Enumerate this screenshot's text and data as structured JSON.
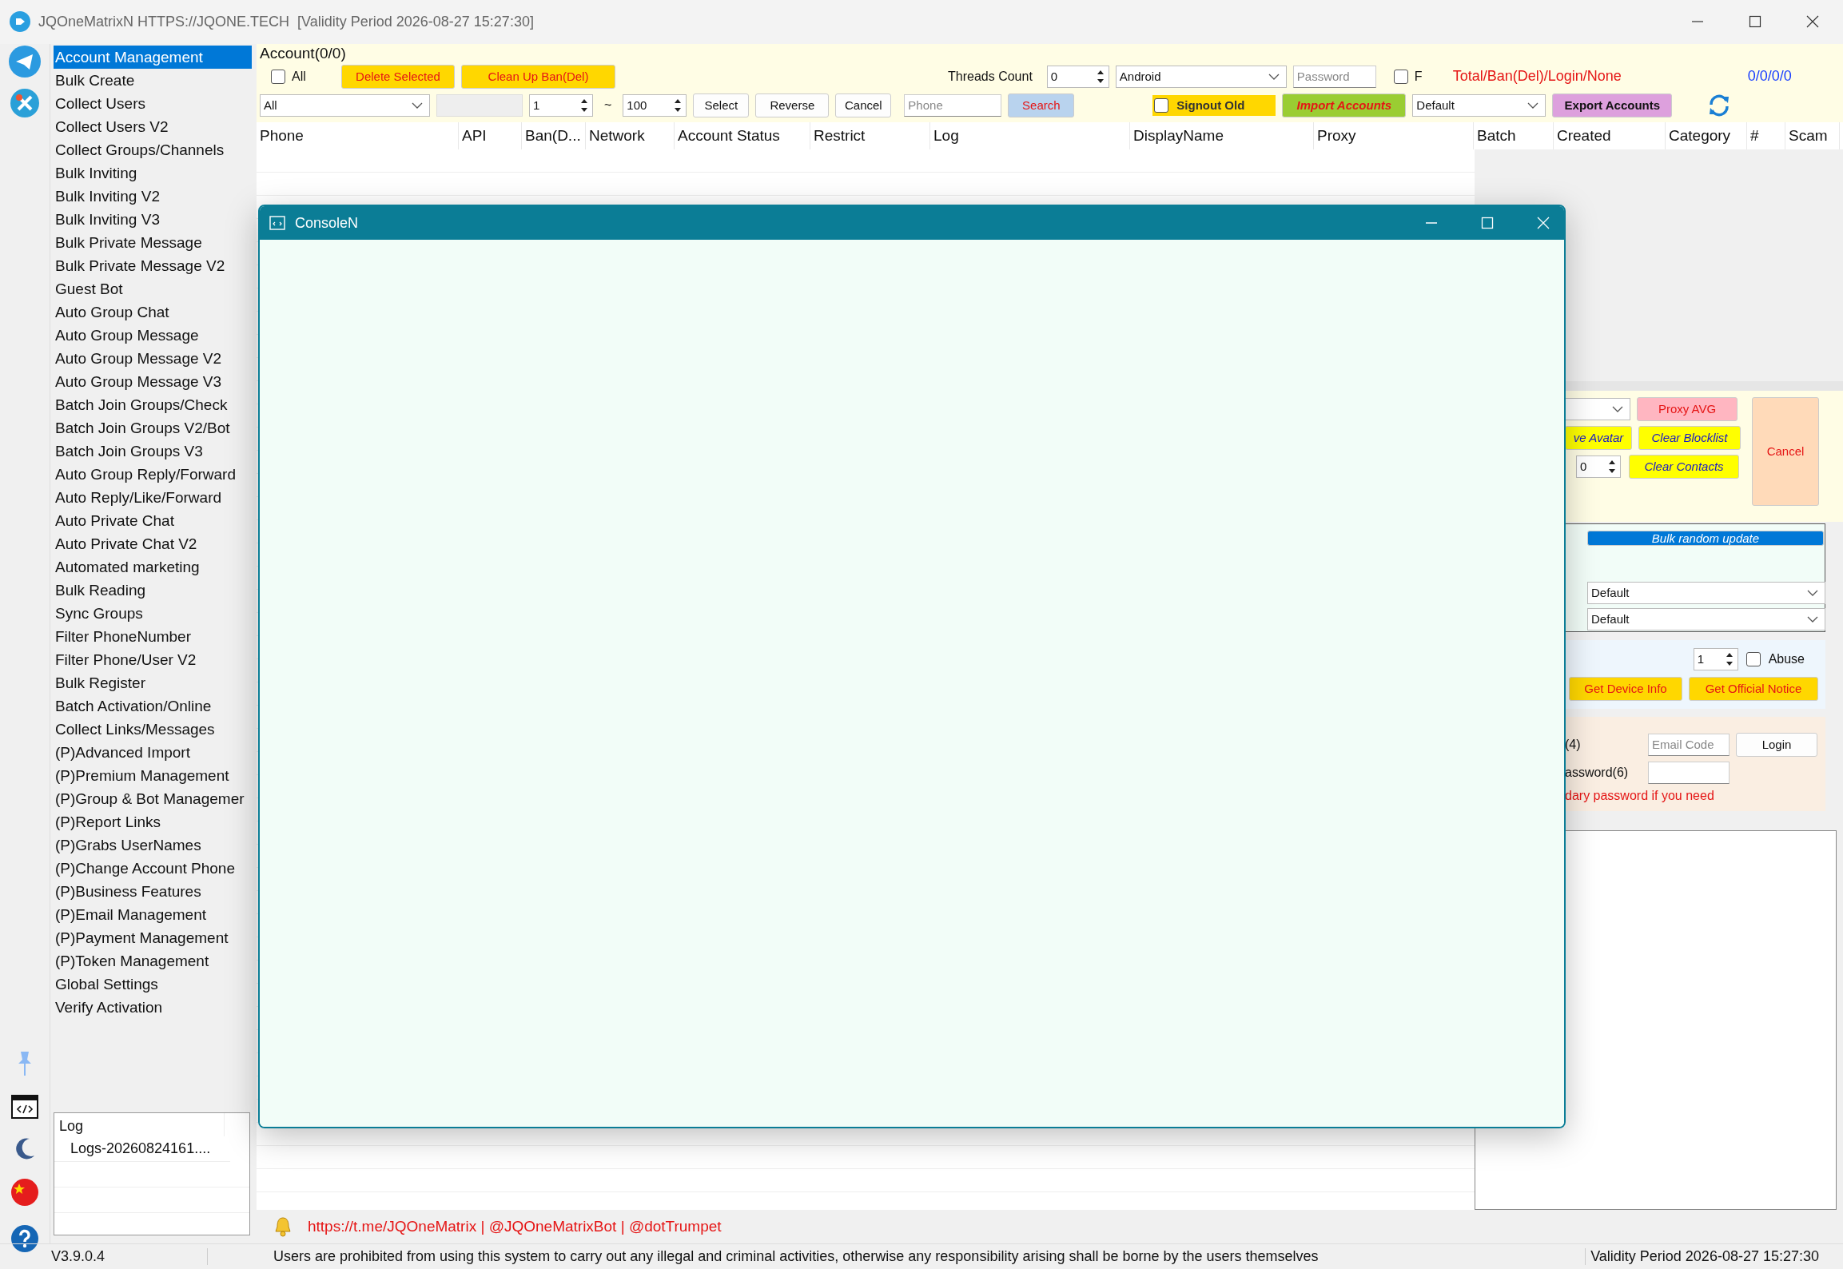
{
  "window": {
    "title": "JQOneMatrixN HTTPS://JQONE.TECH  [Validity Period 2026-08-27 15:27:30]"
  },
  "sidebar": {
    "items": [
      {
        "label": "Account Management",
        "selected": true
      },
      {
        "label": "Bulk Create",
        "selected": false
      },
      {
        "label": "Collect Users",
        "selected": false
      },
      {
        "label": "Collect Users V2",
        "selected": false
      },
      {
        "label": "Collect Groups/Channels",
        "selected": false
      },
      {
        "label": "Bulk Inviting",
        "selected": false
      },
      {
        "label": "Bulk Inviting V2",
        "selected": false
      },
      {
        "label": "Bulk Inviting V3",
        "selected": false
      },
      {
        "label": "Bulk Private Message",
        "selected": false
      },
      {
        "label": "Bulk Private Message V2",
        "selected": false
      },
      {
        "label": "Guest Bot",
        "selected": false
      },
      {
        "label": "Auto Group Chat",
        "selected": false
      },
      {
        "label": "Auto Group Message",
        "selected": false
      },
      {
        "label": "Auto Group Message V2",
        "selected": false
      },
      {
        "label": "Auto Group Message V3",
        "selected": false
      },
      {
        "label": "Batch Join Groups/Check",
        "selected": false
      },
      {
        "label": "Batch Join Groups V2/Bot",
        "selected": false
      },
      {
        "label": "Batch Join Groups V3",
        "selected": false
      },
      {
        "label": "Auto Group Reply/Forward",
        "selected": false
      },
      {
        "label": "Auto Reply/Like/Forward",
        "selected": false
      },
      {
        "label": "Auto Private Chat",
        "selected": false
      },
      {
        "label": "Auto Private Chat V2",
        "selected": false
      },
      {
        "label": "Automated marketing",
        "selected": false
      },
      {
        "label": "Bulk Reading",
        "selected": false
      },
      {
        "label": "Sync Groups",
        "selected": false
      },
      {
        "label": "Filter PhoneNumber",
        "selected": false
      },
      {
        "label": "Filter Phone/User V2",
        "selected": false
      },
      {
        "label": "Bulk Register",
        "selected": false
      },
      {
        "label": "Batch Activation/Online",
        "selected": false
      },
      {
        "label": "Collect Links/Messages",
        "selected": false
      },
      {
        "label": "(P)Advanced Import",
        "selected": false
      },
      {
        "label": "(P)Premium Management",
        "selected": false
      },
      {
        "label": "(P)Group & Bot Managemer",
        "selected": false
      },
      {
        "label": "(P)Report Links",
        "selected": false
      },
      {
        "label": "(P)Grabs UserNames",
        "selected": false
      },
      {
        "label": "(P)Change Account Phone",
        "selected": false
      },
      {
        "label": "(P)Business Features",
        "selected": false
      },
      {
        "label": "(P)Email Management",
        "selected": false
      },
      {
        "label": "(P)Payment Management",
        "selected": false
      },
      {
        "label": "(P)Token Management",
        "selected": false
      },
      {
        "label": "Global Settings",
        "selected": false
      },
      {
        "label": "Verify Activation",
        "selected": false
      }
    ]
  },
  "log_panel": {
    "header": "Log",
    "items": [
      "Logs-20260824161...."
    ]
  },
  "accounts": {
    "title": "Account(0/0)",
    "all_checkbox": {
      "label": "All",
      "checked": false
    },
    "delete_selected": "Delete Selected",
    "clean_up": "Clean Up Ban(Del)",
    "threads": {
      "label": "Threads Count",
      "value": "0"
    },
    "device": {
      "value": "Android"
    },
    "password": {
      "placeholder": "Password"
    },
    "f_checkbox": {
      "label": "F",
      "checked": false
    },
    "totals": {
      "label": "Total/Ban(Del)/Login/None",
      "value": "0/0/0/0"
    },
    "filter": {
      "value": "All"
    },
    "range_from": "1",
    "range_sep": "~",
    "range_to": "100",
    "select": "Select",
    "reverse": "Reverse",
    "cancel": "Cancel",
    "phone": {
      "placeholder": "Phone"
    },
    "search": "Search",
    "signout_old": {
      "label": "Signout Old",
      "checked": false
    },
    "import": "Import Accounts",
    "category": {
      "value": "Default"
    },
    "export": "Export Accounts"
  },
  "table": {
    "columns": [
      "Phone",
      "API",
      "Ban(D...",
      "Network",
      "Account Status",
      "Restrict",
      "Log",
      "DisplayName",
      "Proxy",
      "Batch",
      "Created",
      "Category",
      "#",
      "Scam"
    ]
  },
  "console": {
    "title": "ConsoleN"
  },
  "right_panel": {
    "proxy_avg": "Proxy AVG",
    "avatar_button": "ve Avatar",
    "clear_blocklist": "Clear Blocklist",
    "contacts_count": "0",
    "clear_contacts": "Clear Contacts",
    "cancel": "Cancel",
    "bulk_random_update": "Bulk random update",
    "select_1": "Default",
    "select_2": "Default",
    "notice_count": "1",
    "abuse": {
      "label": "Abuse",
      "checked": false
    },
    "get_device_info": "Get Device Info",
    "get_official_notice": "Get Official Notice",
    "label_1": "(4)",
    "email_code": {
      "placeholder": "Email Code"
    },
    "login": "Login",
    "label_2": "assword(6)",
    "hint": "dary password if you need"
  },
  "footer": {
    "links": "https://t.me/JQOneMatrix | @JQOneMatrixBot | @dotTrumpet"
  },
  "status_bar": {
    "version": "V3.9.0.4",
    "notice": "Users are prohibited from using this system to carry out any illegal and criminal activities, otherwise any responsibility arising shall be borne by the users themselves",
    "validity": "Validity Period 2026-08-27 15:27:30"
  }
}
